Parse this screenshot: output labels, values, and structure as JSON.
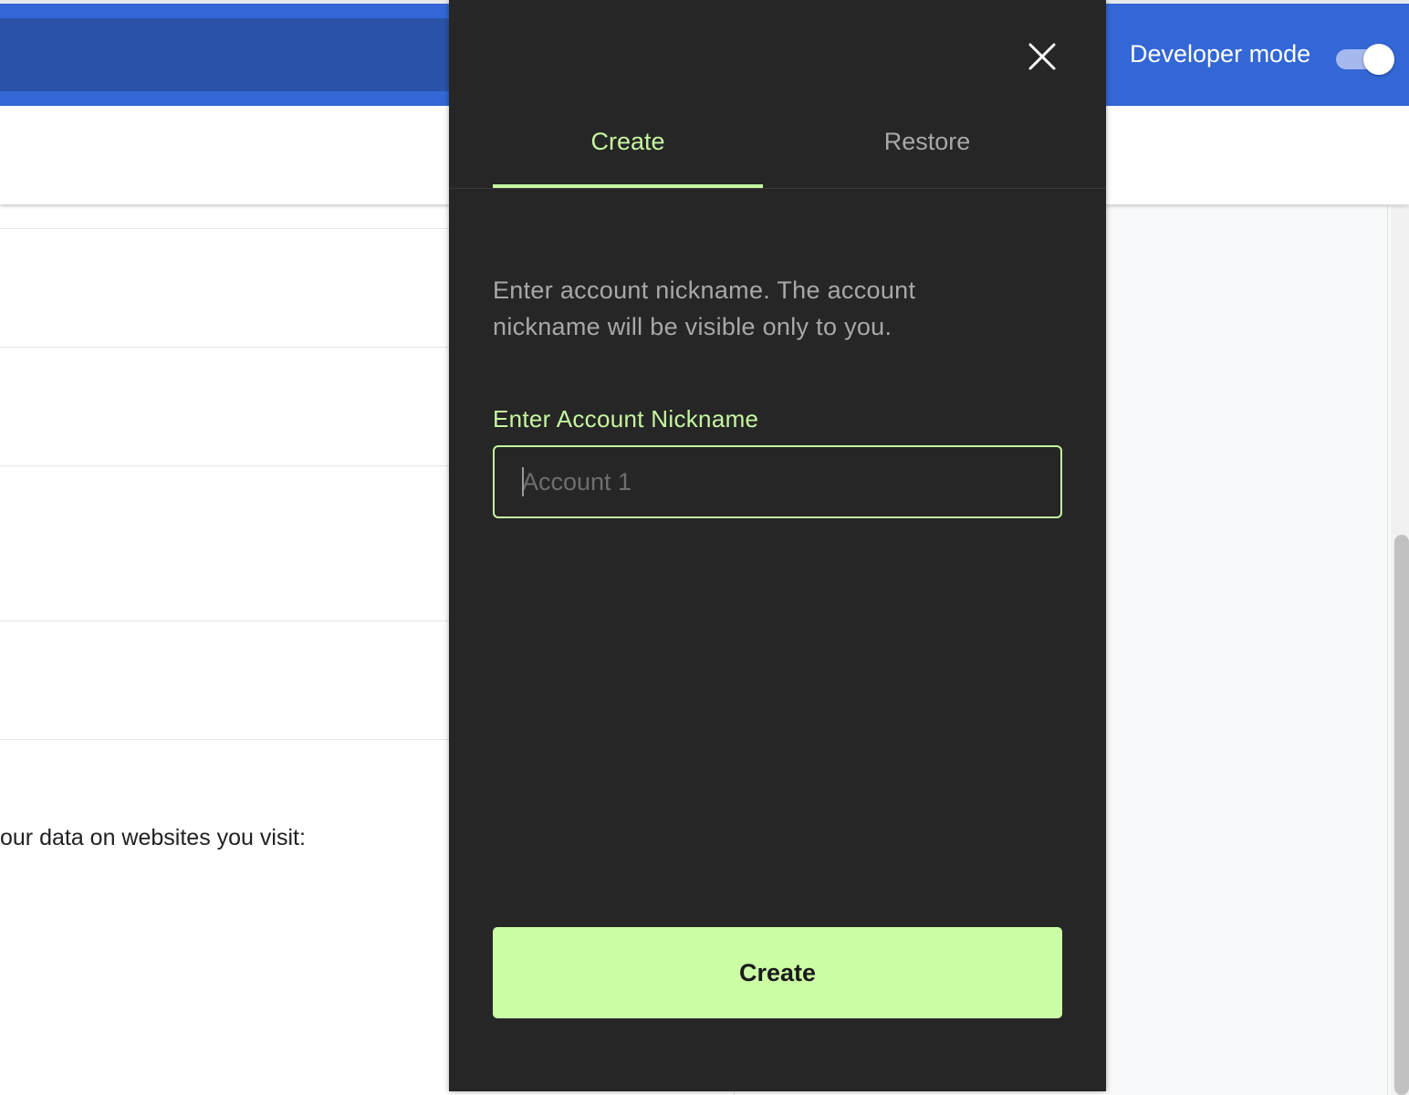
{
  "background": {
    "header": {
      "developer_mode_label": "Developer mode",
      "developer_mode_enabled": true
    },
    "partial_text": "our data on websites you visit:"
  },
  "popup": {
    "tabs": [
      {
        "label": "Create",
        "active": true
      },
      {
        "label": "Restore",
        "active": false
      }
    ],
    "description": "Enter account nickname. The account nickname will be visible only to you.",
    "nickname_field": {
      "label": "Enter Account Nickname",
      "value": "",
      "placeholder": "Account 1"
    },
    "create_button_label": "Create",
    "close_icon": "close-icon"
  },
  "colors": {
    "accent": "#c6f6a0",
    "button_bg": "#ccfea6",
    "popup_bg": "#262626",
    "header_blue": "#3367d6"
  }
}
